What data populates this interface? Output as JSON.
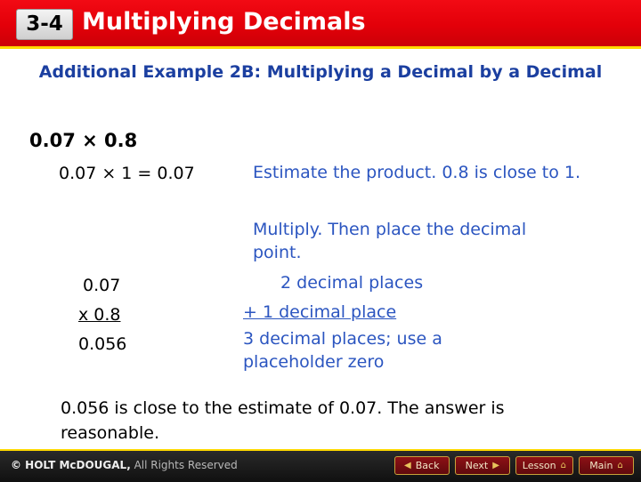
{
  "header": {
    "lesson_number": "3-4",
    "title": "Multiplying Decimals"
  },
  "example": {
    "heading": "Additional Example 2B: Multiplying a Decimal by a Decimal"
  },
  "work": {
    "problem": "0.07 × 0.8",
    "estimate_step": "0.07 × 1 = 0.07",
    "note_estimate": "Estimate the product. 0.8 is close to 1.",
    "note_multiply": "Multiply. Then place the decimal point.",
    "note_places_2": "2 decimal places",
    "note_places_1": "+ 1 decimal place",
    "note_places_3": "3 decimal places; use a placeholder zero",
    "vertical": {
      "factor1": "0.07",
      "factor2": "x 0.8",
      "product": "0.056"
    },
    "conclusion": "0.056 is close to the estimate of 0.07. The answer is reasonable."
  },
  "footer": {
    "copyright": "© HOLT McDOUGAL,",
    "rights": " All Rights Reserved",
    "buttons": [
      {
        "label": "Back",
        "icon": "chevron-left-icon",
        "glyph": "◀"
      },
      {
        "label": "Next",
        "icon": "chevron-right-icon",
        "glyph": "▶"
      },
      {
        "label": "Lesson",
        "icon": "home-icon",
        "glyph": "⌂"
      },
      {
        "label": "Main",
        "icon": "home-icon",
        "glyph": "⌂"
      }
    ]
  },
  "colors": {
    "header_red": "#e30009",
    "accent_yellow": "#ffd900",
    "heading_blue": "#1b3fa0",
    "note_blue": "#2b55c0"
  }
}
